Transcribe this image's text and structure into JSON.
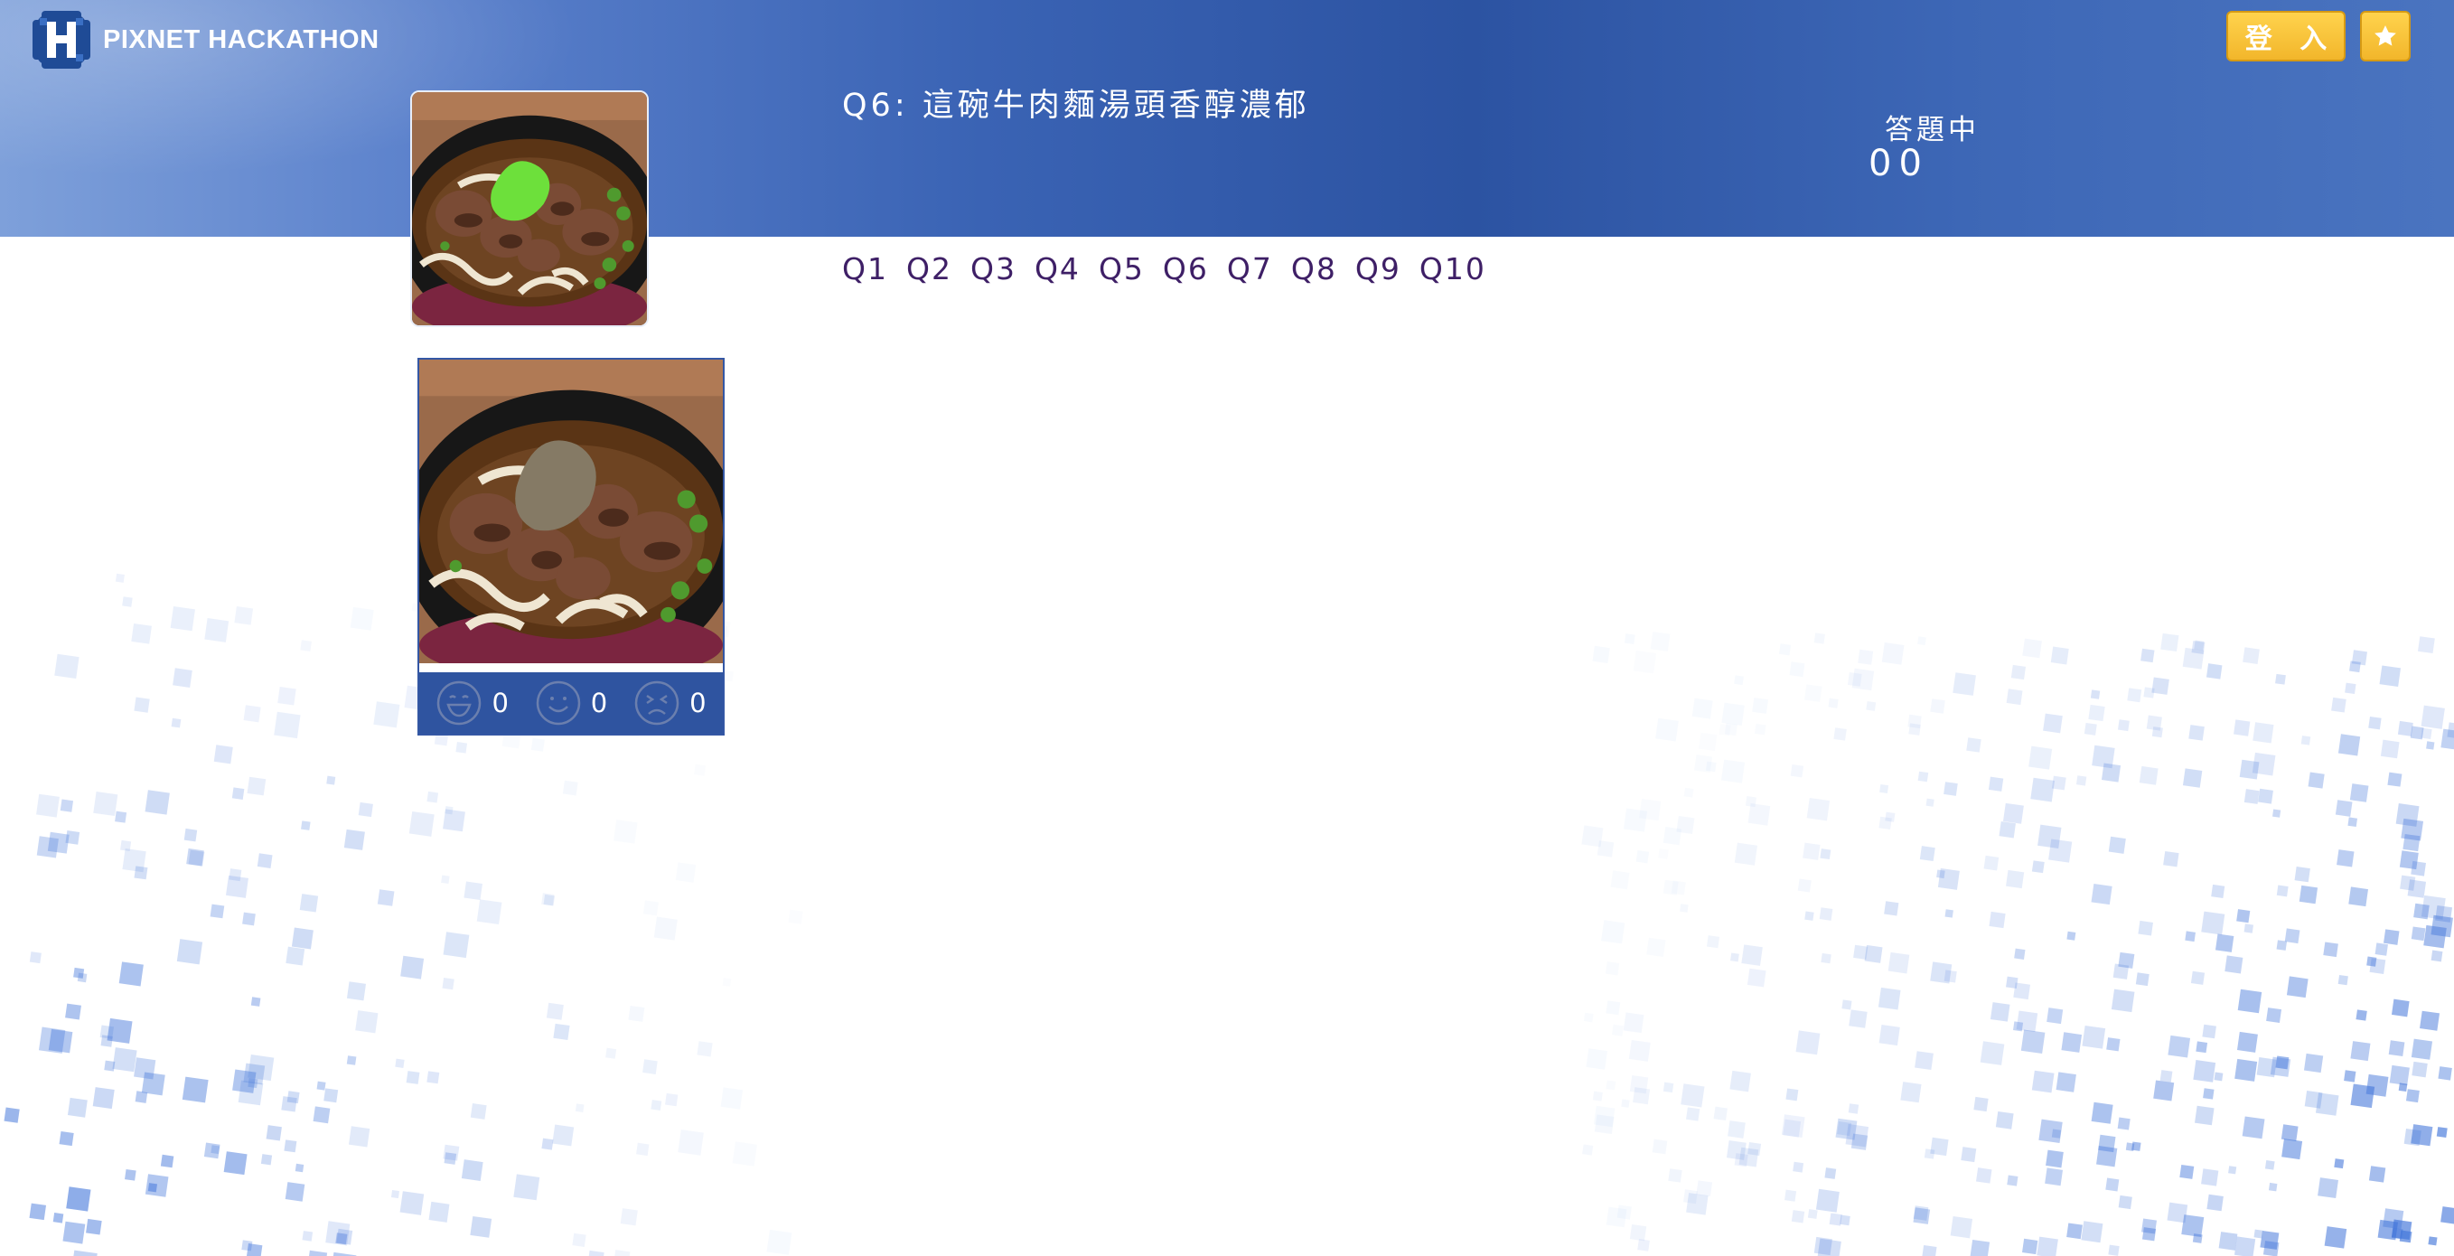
{
  "header": {
    "logo_text": "PIXNET HACKATHON",
    "login_label": "登 入",
    "favorite_icon": "star-icon"
  },
  "question": {
    "title": "Q6: 這碗牛肉麵湯頭香醇濃郁",
    "status": "答題中",
    "timer": "00"
  },
  "question_nav": [
    "Q1",
    "Q2",
    "Q3",
    "Q4",
    "Q5",
    "Q6",
    "Q7",
    "Q8",
    "Q9",
    "Q10"
  ],
  "answer": {
    "votes": [
      {
        "icon": "laughing-face-icon",
        "count": "0"
      },
      {
        "icon": "smiling-face-icon",
        "count": "0"
      },
      {
        "icon": "sad-face-icon",
        "count": "0"
      }
    ]
  },
  "colors": {
    "header_blue": "#2c53a2",
    "button_gold": "#f2b62b",
    "nav_purple": "#3e1f66",
    "highlight_green": "#6de03b",
    "highlight_taupe": "#857a65"
  }
}
